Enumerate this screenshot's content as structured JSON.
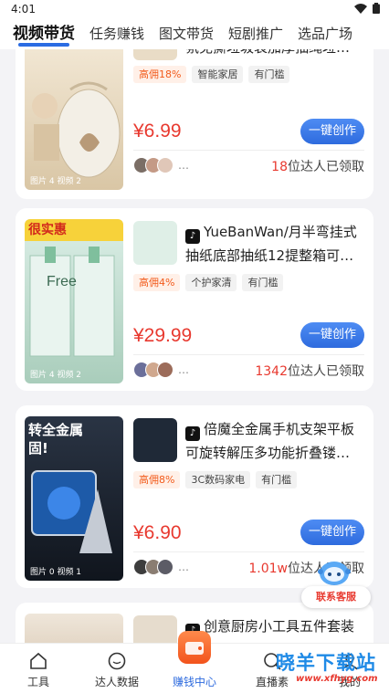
{
  "status": {
    "time": "4:01"
  },
  "top_tabs": [
    {
      "label": "视频带货",
      "active": true
    },
    {
      "label": "任务赚钱",
      "active": false
    },
    {
      "label": "图文带货",
      "active": false
    },
    {
      "label": "短剧推广",
      "active": false
    },
    {
      "label": "选品广场",
      "active": false
    }
  ],
  "products": [
    {
      "title_line1": "",
      "title_line2": "氛免撕垃圾袋加厚抽绳垃…",
      "commission_tag": "高佣18%",
      "category_tag": "智能家居",
      "threshold_tag": "有门槛",
      "price": "¥6.99",
      "create_label": "一键创作",
      "more": "…",
      "claimed_count": "18",
      "claimed_suffix": "位达人已领取",
      "thumb_meta": "图片 4   视频 2",
      "thumb_banner": ""
    },
    {
      "title_line1": "YueBanWan/月半弯挂式",
      "title_line2": "抽纸底部抽纸12提整箱可…",
      "commission_tag": "高佣4%",
      "category_tag": "个护家清",
      "threshold_tag": "有门槛",
      "price": "¥29.99",
      "create_label": "一键创作",
      "more": "…",
      "claimed_count": "1342",
      "claimed_suffix": "位达人已领取",
      "thumb_meta": "图片 4   视频 2",
      "thumb_banner": "很实惠",
      "thumb_brand": "Free"
    },
    {
      "title_line1": "倍魔全金属手机支架平板",
      "title_line2": "可旋转解压多功能折叠镂…",
      "commission_tag": "高佣8%",
      "category_tag": "3C数码家电",
      "threshold_tag": "有门槛",
      "price": "¥6.90",
      "create_label": "一键创作",
      "more": "…",
      "claimed_count": "1.01w",
      "claimed_suffix": "位达人已领取",
      "thumb_meta": "图片 0   视频 1",
      "thumb_banner": "转全金属",
      "thumb_banner2": "固!"
    },
    {
      "title_line1": "创意厨房小工具五件套装",
      "title_line2": ""
    }
  ],
  "support": {
    "label": "联系客服"
  },
  "bottom_nav": [
    {
      "label": "工具",
      "icon": "home-icon"
    },
    {
      "label": "达人数据",
      "icon": "chat-icon"
    },
    {
      "label": "赚钱中心",
      "icon": "wallet-icon"
    },
    {
      "label": "直播素",
      "icon": "search-icon"
    },
    {
      "label": "我的",
      "icon": "profile-icon"
    }
  ],
  "watermark": {
    "text": "晓羊下载站",
    "url": "www.xfhyg.com"
  },
  "colors": {
    "accent": "#2e6bde",
    "price": "#e8392f",
    "commission": "#f25b1c"
  }
}
